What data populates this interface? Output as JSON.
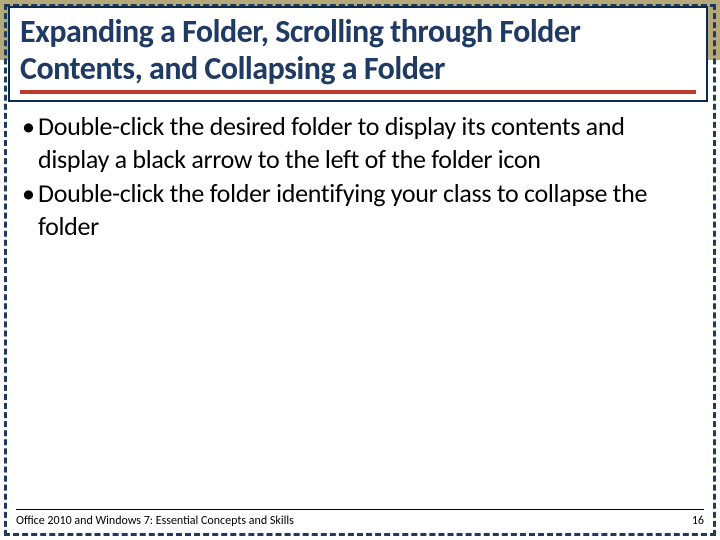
{
  "slide": {
    "title": "Expanding a Folder, Scrolling through Folder Contents, and Collapsing a Folder",
    "bullets": [
      "Double-click the desired folder to display its contents and display a black arrow to the left of the folder icon",
      "Double-click the folder identifying your class to collapse the folder"
    ],
    "footer": {
      "left": "Office 2010 and Windows 7: Essential Concepts and Skills",
      "page": "16"
    }
  }
}
